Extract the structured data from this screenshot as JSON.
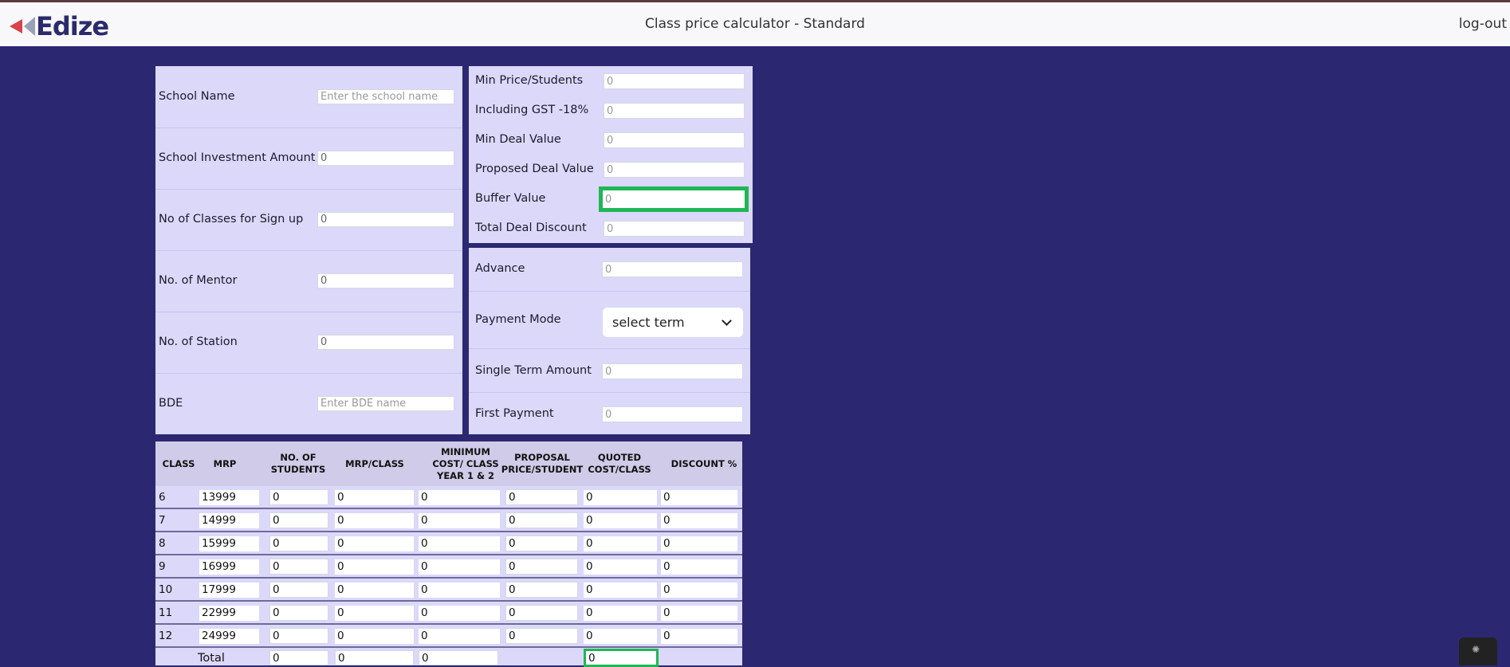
{
  "header": {
    "logo_text": "Edize",
    "title": "Class price calculator - Standard",
    "logout": "log-out"
  },
  "school_form": {
    "school_name": {
      "label": "School Name",
      "value": "",
      "placeholder": "Enter the school name"
    },
    "investment": {
      "label": "School Investment Amount",
      "value": "0",
      "placeholder": ""
    },
    "classes_signup": {
      "label": "No of Classes for Sign up",
      "value": "0",
      "placeholder": ""
    },
    "mentor": {
      "label": "No. of Mentor",
      "value": "0",
      "placeholder": ""
    },
    "station": {
      "label": "No. of Station",
      "value": "0",
      "placeholder": ""
    },
    "bde": {
      "label": "BDE",
      "value": "",
      "placeholder": "Enter BDE name"
    }
  },
  "deal_form": {
    "min_price": {
      "label": "Min Price/Students",
      "value": "",
      "placeholder": "0"
    },
    "gst": {
      "label": "Including GST -18%",
      "value": "",
      "placeholder": "0"
    },
    "min_deal": {
      "label": "Min Deal Value",
      "value": "",
      "placeholder": "0"
    },
    "proposed_deal": {
      "label": "Proposed Deal Value",
      "value": "",
      "placeholder": "0"
    },
    "buffer": {
      "label": "Buffer Value",
      "value": "",
      "placeholder": "0"
    },
    "total_discount": {
      "label": "Total Deal Discount",
      "value": "",
      "placeholder": "0"
    }
  },
  "payment_form": {
    "advance": {
      "label": "Advance",
      "value": "",
      "placeholder": "0"
    },
    "payment_mode": {
      "label": "Payment Mode",
      "selected": "select term"
    },
    "single_term": {
      "label": "Single Term Amount",
      "value": "",
      "placeholder": "0"
    },
    "first_payment": {
      "label": "First Payment",
      "value": "",
      "placeholder": "0"
    }
  },
  "class_table": {
    "headers": {
      "class": "CLASS",
      "mrp": "MRP",
      "students": "NO. OF STUDENTS",
      "mrp_class": "MRP/CLASS",
      "min_cost": "MINIMUM COST/ CLASS YEAR 1 & 2",
      "proposal_price": "PROPOSAL PRICE/STUDENT",
      "quoted_cost": "QUOTED COST/CLASS",
      "discount": "DISCOUNT %"
    },
    "rows": [
      {
        "class": "6",
        "mrp": "13999",
        "students": "0",
        "mrp_class": "0",
        "min_cost": "0",
        "proposal": "0",
        "quoted": "0",
        "discount": "0"
      },
      {
        "class": "7",
        "mrp": "14999",
        "students": "0",
        "mrp_class": "0",
        "min_cost": "0",
        "proposal": "0",
        "quoted": "0",
        "discount": "0"
      },
      {
        "class": "8",
        "mrp": "15999",
        "students": "0",
        "mrp_class": "0",
        "min_cost": "0",
        "proposal": "0",
        "quoted": "0",
        "discount": "0"
      },
      {
        "class": "9",
        "mrp": "16999",
        "students": "0",
        "mrp_class": "0",
        "min_cost": "0",
        "proposal": "0",
        "quoted": "0",
        "discount": "0"
      },
      {
        "class": "10",
        "mrp": "17999",
        "students": "0",
        "mrp_class": "0",
        "min_cost": "0",
        "proposal": "0",
        "quoted": "0",
        "discount": "0"
      },
      {
        "class": "11",
        "mrp": "22999",
        "students": "0",
        "mrp_class": "0",
        "min_cost": "0",
        "proposal": "0",
        "quoted": "0",
        "discount": "0"
      },
      {
        "class": "12",
        "mrp": "24999",
        "students": "0",
        "mrp_class": "0",
        "min_cost": "0",
        "proposal": "0",
        "quoted": "0",
        "discount": "0"
      }
    ],
    "total": {
      "label": "Total",
      "students": "0",
      "mrp_class": "0",
      "min_cost": "0",
      "quoted": "0"
    }
  },
  "colors": {
    "background": "#2b2871",
    "panel": "#dcd8fa",
    "highlight": "#20b656",
    "logo_arrow": "#d8434a"
  },
  "icons": {
    "logo": "edize-logo-arrow",
    "dropdown": "chevron-down-icon",
    "badge": "blackbox-icon"
  }
}
